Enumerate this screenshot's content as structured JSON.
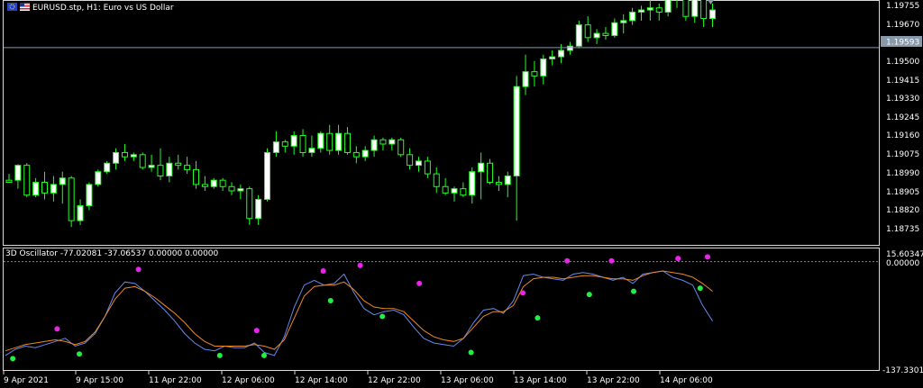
{
  "main_chart": {
    "symbol_title": "EURUSD.stp, H1:  Euro vs US Dollar",
    "price_labels": [
      "1.19755",
      "1.19670",
      "1.19500",
      "1.19415",
      "1.19330",
      "1.19245",
      "1.19160",
      "1.19075",
      "1.18990",
      "1.18905",
      "1.18820",
      "1.18735"
    ],
    "current_price": "1.19593",
    "colors": {
      "bull": "#ffffff",
      "bear_body": "#000000",
      "wick": "#22ff22",
      "border": "#d8d8d8",
      "current_line": "#8899aa"
    },
    "candles": [
      [
        1.1897,
        1.19,
        1.1896,
        1.1896
      ],
      [
        1.1897,
        1.19045,
        1.1893,
        1.1904
      ],
      [
        1.1904,
        1.1905,
        1.1889,
        1.189
      ],
      [
        1.189,
        1.1898,
        1.1889,
        1.1896
      ],
      [
        1.1896,
        1.1901,
        1.1888,
        1.1891
      ],
      [
        1.1891,
        1.1899,
        1.1887,
        1.1895
      ],
      [
        1.1895,
        1.1901,
        1.1886,
        1.1898
      ],
      [
        1.1898,
        1.1899,
        1.1875,
        1.1878
      ],
      [
        1.1878,
        1.1888,
        1.1876,
        1.1885
      ],
      [
        1.1885,
        1.1896,
        1.1883,
        1.1895
      ],
      [
        1.1895,
        1.1902,
        1.1894,
        1.1901
      ],
      [
        1.1901,
        1.1906,
        1.19,
        1.1905
      ],
      [
        1.1905,
        1.1912,
        1.1902,
        1.191
      ],
      [
        1.191,
        1.1914,
        1.1906,
        1.1908
      ],
      [
        1.1908,
        1.191,
        1.1906,
        1.1909
      ],
      [
        1.1909,
        1.191,
        1.1902,
        1.1903
      ],
      [
        1.1903,
        1.1909,
        1.1901,
        1.1904
      ],
      [
        1.1904,
        1.1912,
        1.1897,
        1.1899
      ],
      [
        1.1899,
        1.1908,
        1.1896,
        1.1905
      ],
      [
        1.1905,
        1.1909,
        1.1902,
        1.1904
      ],
      [
        1.1904,
        1.1908,
        1.19,
        1.1902
      ],
      [
        1.1902,
        1.1906,
        1.1893,
        1.1895
      ],
      [
        1.1895,
        1.1899,
        1.1892,
        1.1894
      ],
      [
        1.1894,
        1.1898,
        1.1893,
        1.1897
      ],
      [
        1.1897,
        1.1898,
        1.1892,
        1.1894
      ],
      [
        1.1894,
        1.1896,
        1.189,
        1.1892
      ],
      [
        1.1892,
        1.1895,
        1.1888,
        1.1893
      ],
      [
        1.1893,
        1.1894,
        1.1876,
        1.1879
      ],
      [
        1.1879,
        1.189,
        1.1876,
        1.1888
      ],
      [
        1.1888,
        1.1912,
        1.1887,
        1.191
      ],
      [
        1.191,
        1.192,
        1.1908,
        1.1915
      ],
      [
        1.1915,
        1.1916,
        1.191,
        1.1913
      ],
      [
        1.1913,
        1.192,
        1.1909,
        1.1918
      ],
      [
        1.1918,
        1.1921,
        1.1908,
        1.191
      ],
      [
        1.191,
        1.1918,
        1.1908,
        1.1912
      ],
      [
        1.1912,
        1.192,
        1.191,
        1.1919
      ],
      [
        1.1919,
        1.1923,
        1.1909,
        1.1911
      ],
      [
        1.1911,
        1.1923,
        1.1909,
        1.1919
      ],
      [
        1.1919,
        1.1922,
        1.1909,
        1.191
      ],
      [
        1.191,
        1.1913,
        1.1905,
        1.1908
      ],
      [
        1.1908,
        1.1913,
        1.1906,
        1.1911
      ],
      [
        1.1911,
        1.1918,
        1.1908,
        1.1916
      ],
      [
        1.1916,
        1.1917,
        1.1911,
        1.1914
      ],
      [
        1.1914,
        1.1917,
        1.1911,
        1.1916
      ],
      [
        1.1916,
        1.1917,
        1.1908,
        1.1909
      ],
      [
        1.1909,
        1.1912,
        1.1902,
        1.1904
      ],
      [
        1.1904,
        1.1908,
        1.1901,
        1.1906
      ],
      [
        1.1906,
        1.1908,
        1.1898,
        1.19
      ],
      [
        1.19,
        1.1903,
        1.1891,
        1.1894
      ],
      [
        1.1894,
        1.1898,
        1.189,
        1.1891
      ],
      [
        1.1891,
        1.1894,
        1.1887,
        1.1893
      ],
      [
        1.1893,
        1.1896,
        1.1889,
        1.189
      ],
      [
        1.189,
        1.1903,
        1.1886,
        1.1901
      ],
      [
        1.1901,
        1.191,
        1.1888,
        1.1905
      ],
      [
        1.1905,
        1.1907,
        1.1895,
        1.1896
      ],
      [
        1.1896,
        1.1899,
        1.1892,
        1.1895
      ],
      [
        1.1895,
        1.1901,
        1.1889,
        1.1899
      ],
      [
        1.1899,
        1.1946,
        1.1878,
        1.1941
      ],
      [
        1.1941,
        1.1956,
        1.1937,
        1.1948
      ],
      [
        1.1948,
        1.1953,
        1.1941,
        1.1946
      ],
      [
        1.1946,
        1.1956,
        1.1942,
        1.1954
      ],
      [
        1.1954,
        1.1958,
        1.1951,
        1.1955
      ],
      [
        1.1955,
        1.1961,
        1.1952,
        1.1958
      ],
      [
        1.1958,
        1.1962,
        1.1956,
        1.196
      ],
      [
        1.196,
        1.1972,
        1.1959,
        1.197
      ],
      [
        1.197,
        1.1974,
        1.1962,
        1.1964
      ],
      [
        1.1964,
        1.1968,
        1.1961,
        1.1966
      ],
      [
        1.1966,
        1.1969,
        1.1963,
        1.1965
      ],
      [
        1.1965,
        1.1973,
        1.1964,
        1.1971
      ],
      [
        1.1971,
        1.1975,
        1.1966,
        1.1972
      ],
      [
        1.1972,
        1.1978,
        1.197,
        1.1976
      ],
      [
        1.1976,
        1.1979,
        1.1972,
        1.1977
      ],
      [
        1.1977,
        1.1982,
        1.1972,
        1.1978
      ],
      [
        1.1978,
        1.198,
        1.1972,
        1.1976
      ],
      [
        1.1976,
        1.1983,
        1.1974,
        1.1982
      ],
      [
        1.1982,
        1.1988,
        1.1978,
        1.1987
      ],
      [
        1.1987,
        1.1991,
        1.1972,
        1.1974
      ],
      [
        1.1974,
        1.1987,
        1.1971,
        1.1984
      ],
      [
        1.1984,
        1.1986,
        1.1969,
        1.1973
      ],
      [
        1.1973,
        1.198,
        1.1969,
        1.1977
      ]
    ]
  },
  "oscillator": {
    "label": "3D Oscillator -77.02081 -37.06537 0.00000 0.00000",
    "scale_labels": [
      "15.60347",
      "0.00000",
      "-137.33010"
    ],
    "colors": {
      "fast": "#6688ee",
      "slow": "#ee8822",
      "buy_dot": "#22ee44",
      "sell_dot": "#ee22ee",
      "zero_line": "#888888"
    },
    "fast_line": [
      -120,
      -112,
      -108,
      -110,
      -106,
      -102,
      -98,
      -108,
      -104,
      -92,
      -70,
      -40,
      -26,
      -28,
      -38,
      -50,
      -62,
      -76,
      -92,
      -104,
      -112,
      -114,
      -108,
      -110,
      -110,
      -104,
      -116,
      -120,
      -96,
      -58,
      -30,
      -24,
      -30,
      -28,
      -16,
      -40,
      -60,
      -68,
      -64,
      -62,
      -68,
      -84,
      -98,
      -104,
      -106,
      -108,
      -98,
      -78,
      -62,
      -60,
      -66,
      -50,
      -18,
      -16,
      -20,
      -22,
      -24,
      -16,
      -14,
      -16,
      -20,
      -24,
      -20,
      -28,
      -16,
      -14,
      -12,
      -20,
      -24,
      -30,
      -56,
      -76
    ],
    "slow_line": [
      -114,
      -110,
      -106,
      -104,
      -102,
      -100,
      -102,
      -106,
      -102,
      -90,
      -70,
      -48,
      -34,
      -32,
      -38,
      -46,
      -56,
      -66,
      -78,
      -92,
      -102,
      -108,
      -108,
      -108,
      -108,
      -106,
      -108,
      -112,
      -100,
      -72,
      -44,
      -32,
      -30,
      -30,
      -26,
      -36,
      -50,
      -58,
      -60,
      -60,
      -64,
      -76,
      -88,
      -96,
      -100,
      -102,
      -98,
      -84,
      -70,
      -64,
      -64,
      -56,
      -32,
      -22,
      -20,
      -20,
      -22,
      -20,
      -18,
      -18,
      -20,
      -22,
      -22,
      -24,
      -18,
      -14,
      -12,
      -14,
      -16,
      -20,
      -28,
      -38
    ],
    "buy_signals": [
      [
        1,
        -124
      ],
      [
        10,
        -118
      ],
      [
        29,
        -120
      ],
      [
        35,
        -120
      ],
      [
        44,
        -50
      ],
      [
        51,
        -70
      ],
      [
        63,
        -116
      ],
      [
        72,
        -72
      ],
      [
        79,
        -42
      ],
      [
        85,
        -38
      ],
      [
        94,
        -34
      ]
    ],
    "sell_signals": [
      [
        7,
        -86
      ],
      [
        18,
        -10
      ],
      [
        34,
        -88
      ],
      [
        43,
        -12
      ],
      [
        48,
        -5
      ],
      [
        56,
        -28
      ],
      [
        70,
        -40
      ],
      [
        76,
        1
      ],
      [
        82,
        1
      ],
      [
        91,
        4
      ],
      [
        95,
        6
      ]
    ]
  },
  "time_axis": {
    "labels": [
      "9 Apr 2021",
      "9 Apr 15:00",
      "11 Apr 22:00",
      "12 Apr 06:00",
      "12 Apr 14:00",
      "12 Apr 22:00",
      "13 Apr 06:00",
      "13 Apr 14:00",
      "13 Apr 22:00",
      "14 Apr 06:00"
    ]
  }
}
